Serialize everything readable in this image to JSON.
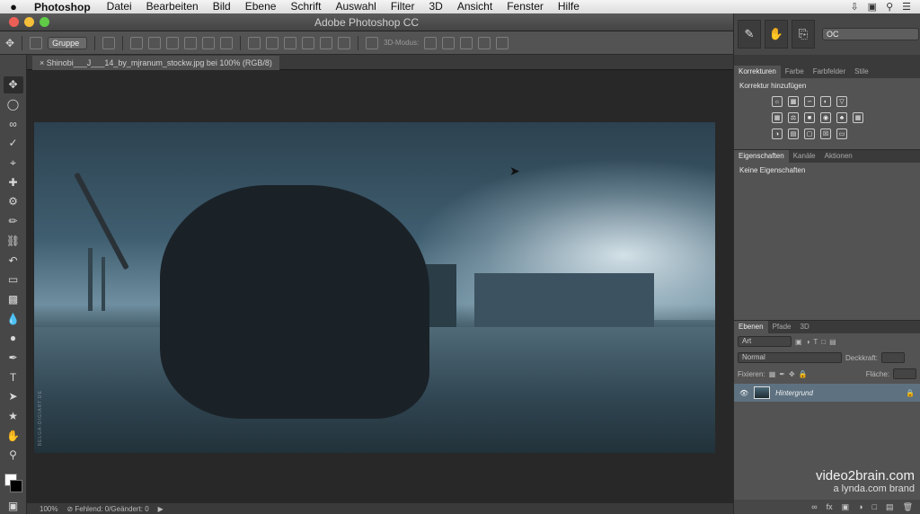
{
  "menubar": {
    "apple": "",
    "app_name": "Photoshop",
    "items": [
      "Datei",
      "Bearbeiten",
      "Bild",
      "Ebene",
      "Schrift",
      "Auswahl",
      "Filter",
      "3D",
      "Ansicht",
      "Fenster",
      "Hilfe"
    ]
  },
  "window": {
    "title": "Adobe Photoshop CC"
  },
  "options": {
    "auto_select": "Gruppe",
    "mode_label": "3D-Modus:"
  },
  "workspace": {
    "selected": "OC"
  },
  "document": {
    "tab_label": "Shinobi___J___14_by_mjranum_stockw.jpg bei 100% (RGB/8)",
    "watermark": "BELGA-DIGIART.DE"
  },
  "status": {
    "zoom": "100%",
    "info": "⊘ Fehlend: 0/Geändert: 0"
  },
  "panels": {
    "adjustments": {
      "tabs": [
        "Korrekturen",
        "Farbe",
        "Farbfelder",
        "Stile"
      ],
      "heading": "Korrektur hinzufügen"
    },
    "properties": {
      "tabs": [
        "Eigenschaften",
        "Kanäle",
        "Aktionen"
      ],
      "empty": "Keine Eigenschaften"
    },
    "layers": {
      "tabs": [
        "Ebenen",
        "Pfade",
        "3D"
      ],
      "filter": "Art",
      "blend_mode": "Normal",
      "opacity_label": "Deckkraft:",
      "lock_label": "Fixieren:",
      "fill_label": "Fläche:",
      "items": [
        {
          "name": "Hintergrund"
        }
      ]
    }
  },
  "brand": {
    "line1": "video2brain.com",
    "line2": "a lynda.com brand"
  }
}
